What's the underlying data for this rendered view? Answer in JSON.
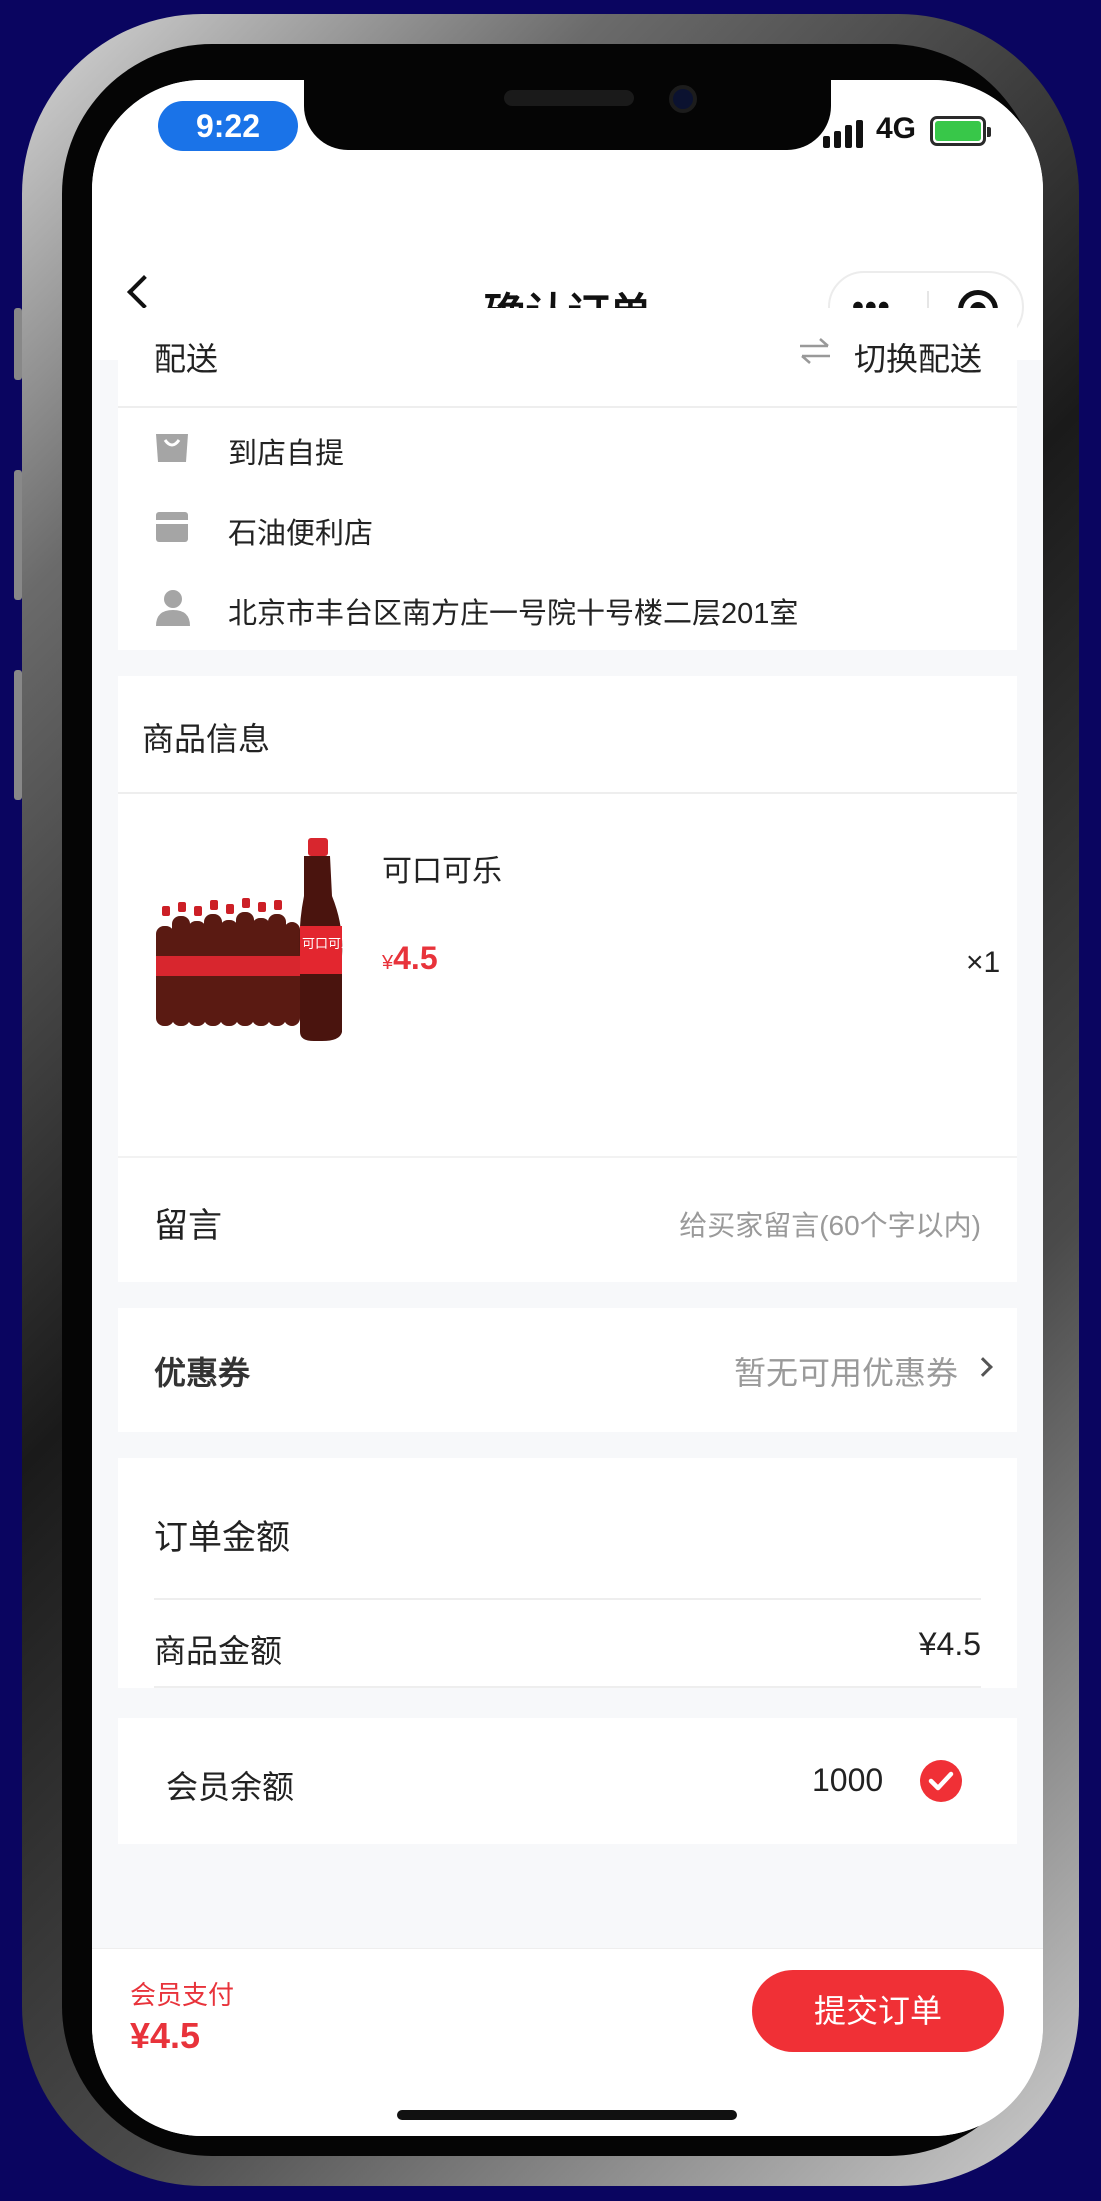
{
  "status": {
    "time": "9:22",
    "network": "4G"
  },
  "nav": {
    "title": "确认订单"
  },
  "delivery": {
    "title": "配送",
    "switch_label": "切换配送",
    "rows": [
      {
        "icon": "bag-icon",
        "text": "到店自提"
      },
      {
        "icon": "store-icon",
        "text": "石油便利店"
      },
      {
        "icon": "user-icon",
        "text": "北京市丰台区南方庄一号院十号楼二层201室"
      }
    ]
  },
  "goods": {
    "title": "商品信息",
    "item": {
      "name": "可口可乐",
      "currency": "¥",
      "price": "4.5",
      "qty": "×1"
    }
  },
  "message": {
    "label": "留言",
    "placeholder": "给买家留言(60个字以内)"
  },
  "coupon": {
    "label": "优惠券",
    "value": "暂无可用优惠券"
  },
  "amount": {
    "title": "订单金额",
    "goods_label": "商品金额",
    "goods_value": "¥4.5"
  },
  "balance": {
    "label": "会员余额",
    "value": "1000"
  },
  "footer": {
    "pay_label": "会员支付",
    "pay_amount": "¥4.5",
    "submit": "提交订单"
  },
  "colors": {
    "accent": "#f03036",
    "status_pill": "#1a73e8",
    "background": "#0a0560"
  }
}
